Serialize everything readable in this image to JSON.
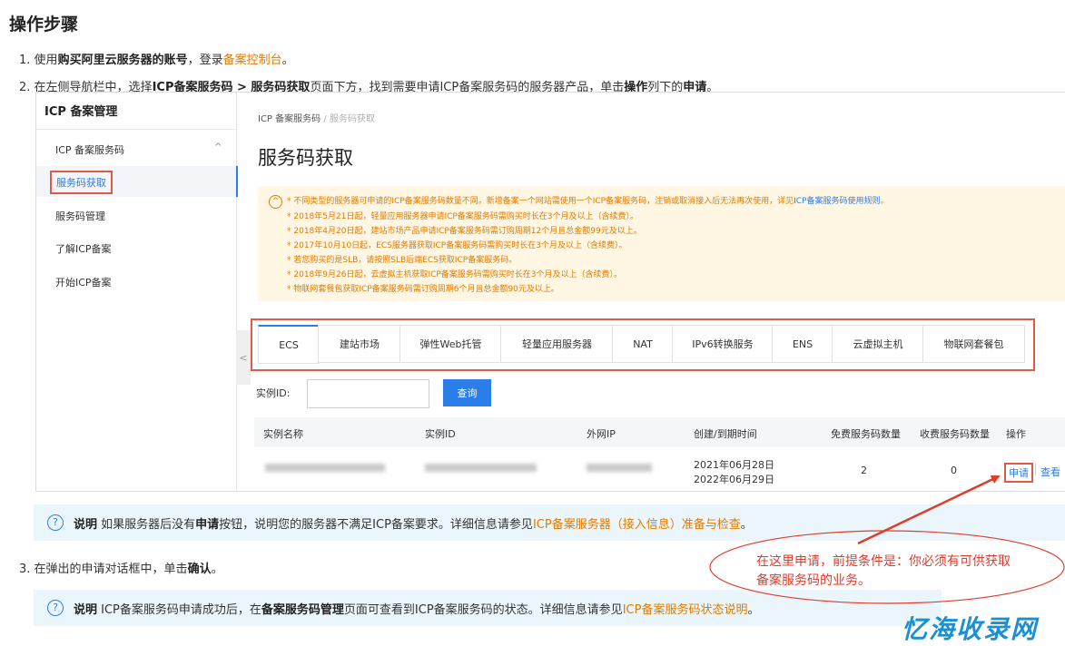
{
  "heading": "操作步骤",
  "steps": {
    "s1": {
      "num": "1.",
      "pre": "使用",
      "bold": "购买阿里云服务器的账号",
      "mid": "，登录",
      "link": "备案控制台",
      "post": "。"
    },
    "s2": {
      "num": "2.",
      "pre": "在左侧导航栏中，选择",
      "b1": "ICP备案服务码",
      "sep": " > ",
      "b2": "服务码获取",
      "mid": "页面下方，找到需要申请ICP备案服务码的服务器产品，单击",
      "b3": "操作",
      "mid2": "列下的",
      "b4": "申请",
      "post": "。"
    },
    "s3": {
      "num": "3.",
      "pre": "在弹出的申请对话框中，单击",
      "bold": "确认",
      "post": "。"
    }
  },
  "console": {
    "sidebar": {
      "title": "ICP 备案管理",
      "group": "ICP 备案服务码",
      "group_chevron": "^",
      "active_item": "服务码获取",
      "items": [
        "服务码管理",
        "了解ICP备案",
        "开始ICP备案"
      ]
    },
    "breadcrumb": {
      "root": "ICP 备案服务码",
      "sep": "/",
      "current": "服务码获取"
    },
    "page_title": "服务码获取",
    "notice_icon": "^",
    "notice": {
      "l1_pre": "* 不同类型的服务器可申请的ICP备案服务码数量不同。新增备案一个网站需使用一个ICP备案服务码，注销或取消接入后无法再次使用，详见",
      "l1_link": "ICP备案服务码使用规则",
      "l1_post": "。",
      "lines": [
        "* 2018年5月21日起，轻量应用服务器申请ICP备案服务码需购买时长在3个月及以上（含续费）。",
        "* 2018年4月20日起，建站市场产品申请ICP备案服务码需订购周期12个月且总金额99元及以上。",
        "* 2017年10月10日起，ECS服务器获取ICP备案服务码需购买时长在3个月及以上（含续费）。",
        "* 若您购买的是SLB，请按照SLB后端ECS获取ICP备案服务码。",
        "* 2018年9月26日起，云虚拟主机获取ICP备案服务码需购买时长在3个月及以上（含续费）。",
        "* 物联网套餐包获取ICP备案服务码需订购周期6个月且总金额90元及以上。"
      ]
    },
    "tabs": [
      "ECS",
      "建站市场",
      "弹性Web托管",
      "轻量应用服务器",
      "NAT",
      "IPv6转换服务",
      "ENS",
      "云虚拟主机",
      "物联网套餐包"
    ],
    "collapse_glyph": "<",
    "search": {
      "label": "实例ID:",
      "value": "",
      "button": "查询"
    },
    "table": {
      "headers": [
        "实例名称",
        "实例ID",
        "外网IP",
        "创建/到期时间",
        "免费服务码数量",
        "收费服务码数量",
        "操作"
      ],
      "row": {
        "created": "2021年06月28日",
        "expires": "2022年06月29日",
        "free": "2",
        "paid": "0",
        "apply": "申请",
        "view": "查看"
      }
    }
  },
  "notes": {
    "n1": {
      "icon": "?",
      "label": "说明",
      "pre": " 如果服务器后没有",
      "bold": "申请",
      "mid": "按钮，说明您的服务器不满足ICP备案要求。详细信息请参见",
      "link": "ICP备案服务器（接入信息）准备与检查",
      "post": "。"
    },
    "n2": {
      "icon": "?",
      "label": "说明",
      "pre": " ICP备案服务码申请成功后，在",
      "bold": "备案服务码管理",
      "mid": "页面可查看到ICP备案服务码的状态。详细信息请参见",
      "link": "ICP备案服务码状态说明",
      "post": "。"
    }
  },
  "callout": {
    "line1": "在这里申请，前提条件是：你必须有可供获取",
    "line2": "备案服务码的业务。"
  },
  "watermark": "忆海收录网",
  "colors": {
    "accent_blue": "#2b7de9",
    "orange": "#e07b00",
    "annotation_red": "#e03c2c"
  }
}
